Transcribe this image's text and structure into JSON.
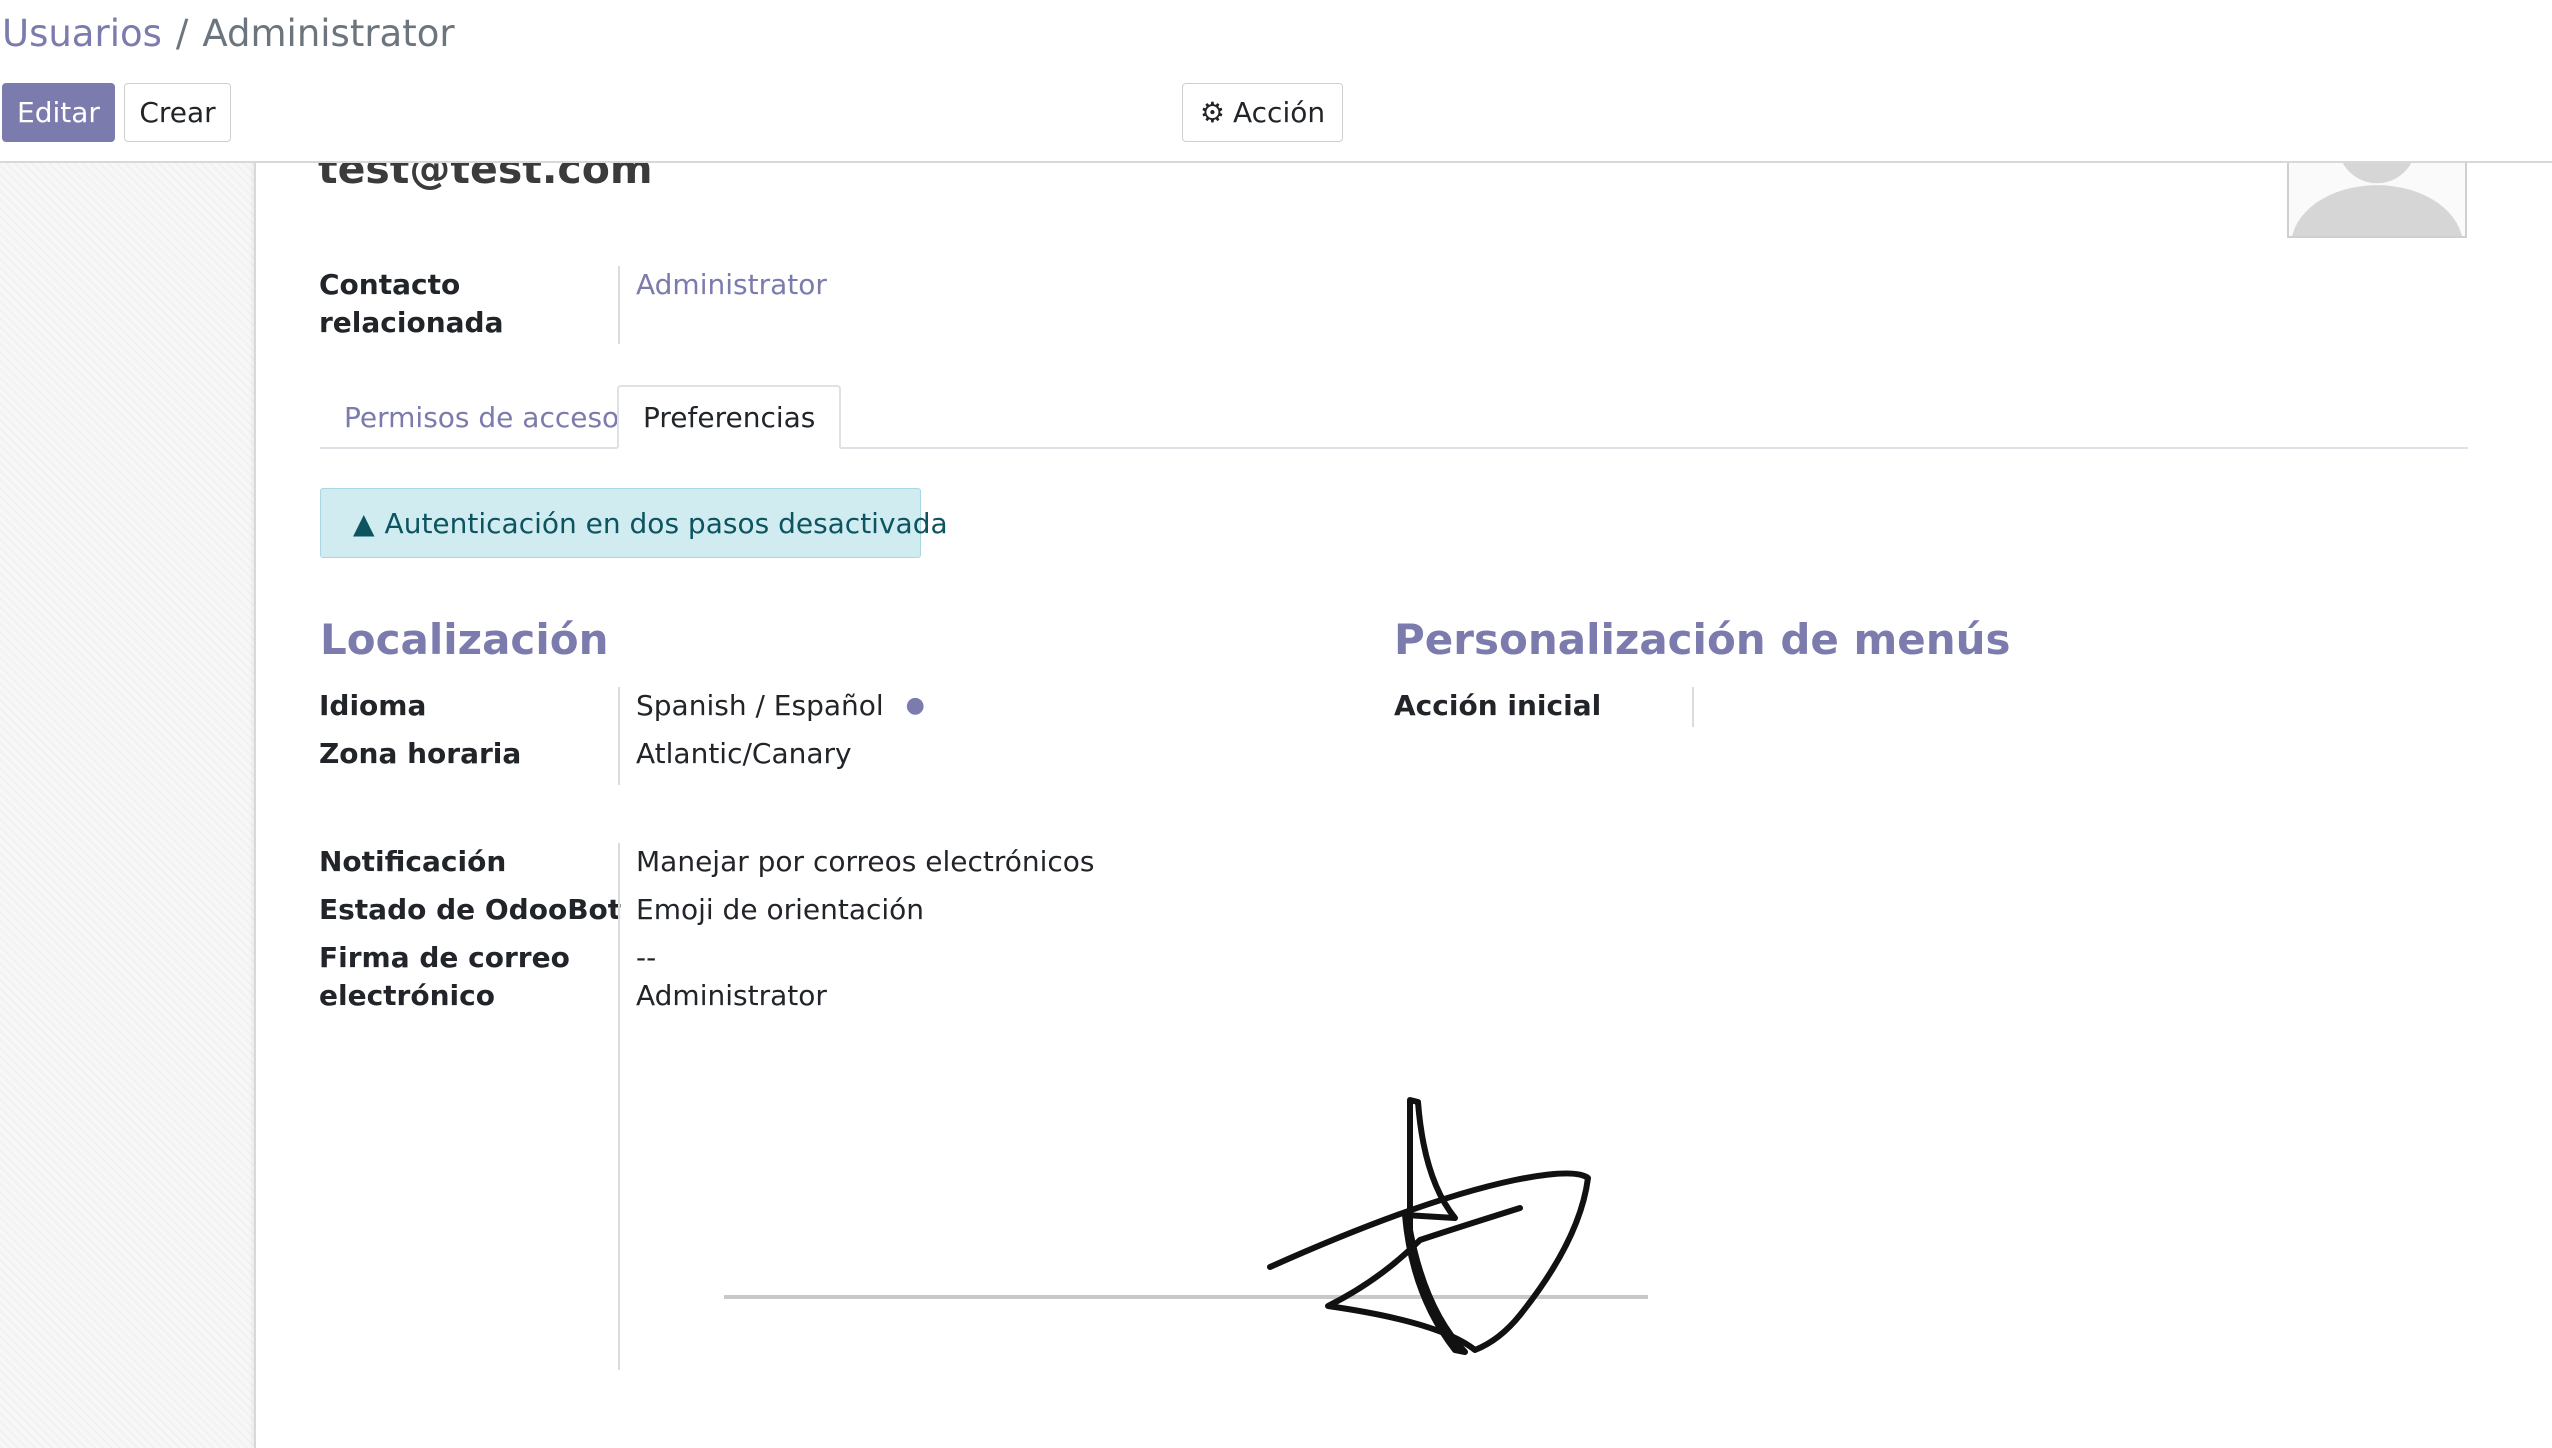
{
  "breadcrumb": {
    "parent": "Usuarios",
    "separator": "/",
    "current": "Administrator"
  },
  "toolbar": {
    "edit_label": "Editar",
    "create_label": "Crear",
    "action_label": "Acción"
  },
  "record": {
    "title": "test@test.com"
  },
  "related_contact": {
    "label_line1": "Contacto",
    "label_line2": "relacionada",
    "value": "Administrator"
  },
  "tabs": [
    {
      "label": "Permisos de acceso",
      "active": false
    },
    {
      "label": "Preferencias",
      "active": true
    }
  ],
  "alert": {
    "text": "Autenticación en dos pasos desactivada"
  },
  "localization": {
    "title": "Localización",
    "language_label": "Idioma",
    "language_value": "Spanish / Español",
    "timezone_label": "Zona horaria",
    "timezone_value": "Atlantic/Canary"
  },
  "menu_customization": {
    "title": "Personalización de menús",
    "home_action_label": "Acción inicial",
    "home_action_value": ""
  },
  "preferences": {
    "notification_label": "Notificación",
    "notification_value": "Manejar por correos electrónicos",
    "odoobot_label": "Estado de OdooBot",
    "odoobot_value": "Emoji de orientación",
    "signature_label_line1": "Firma de correo",
    "signature_label_line2": "electrónico",
    "signature_line1": "--",
    "signature_line2": "Administrator"
  },
  "colors": {
    "brand": "#7c7bad",
    "alert_bg": "#d1ecf1",
    "alert_text": "#0c5460"
  }
}
